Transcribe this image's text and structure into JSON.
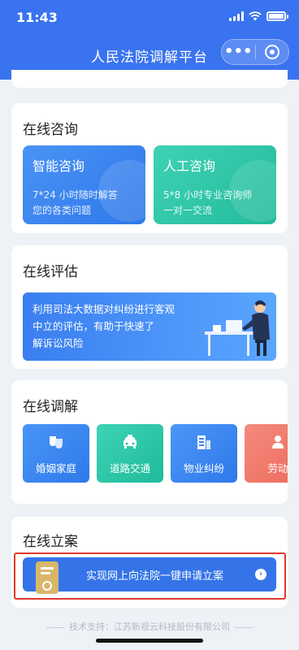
{
  "status_bar": {
    "time": "11:43"
  },
  "nav": {
    "title": "人民法院调解平台",
    "more_label": "•••"
  },
  "consult": {
    "title": "在线咨询",
    "smart": {
      "title": "智能咨询",
      "desc_line1": "7*24 小时随时解答",
      "desc_line2": "您的各类问题"
    },
    "manual": {
      "title": "人工咨询",
      "desc_line1": "5*8 小时专业咨询师",
      "desc_line2": "一对一交流"
    }
  },
  "assess": {
    "title": "在线评估",
    "desc_line1": "利用司法大数据对纠纷进行客观",
    "desc_line2": "中立的评估，有助于快速了",
    "desc_line3": "解诉讼风险"
  },
  "mediation": {
    "title": "在线调解",
    "items": [
      {
        "label": "婚姻家庭"
      },
      {
        "label": "道路交通"
      },
      {
        "label": "物业纠纷"
      },
      {
        "label": "劳动"
      }
    ]
  },
  "filing": {
    "title": "在线立案",
    "button_label": "实现网上向法院一键申请立案"
  },
  "footer": {
    "text": "技术支持：江苏新视云科技股份有限公司"
  },
  "colors": {
    "primary": "#3a73f0",
    "smart_tile": "#3b86f0",
    "manual_tile": "#2ec7a8",
    "marriage": "#3a86f0",
    "traffic": "#2ccaa8",
    "property": "#3c86f2",
    "labor": "#f0786a",
    "highlight": "#e0392f"
  }
}
